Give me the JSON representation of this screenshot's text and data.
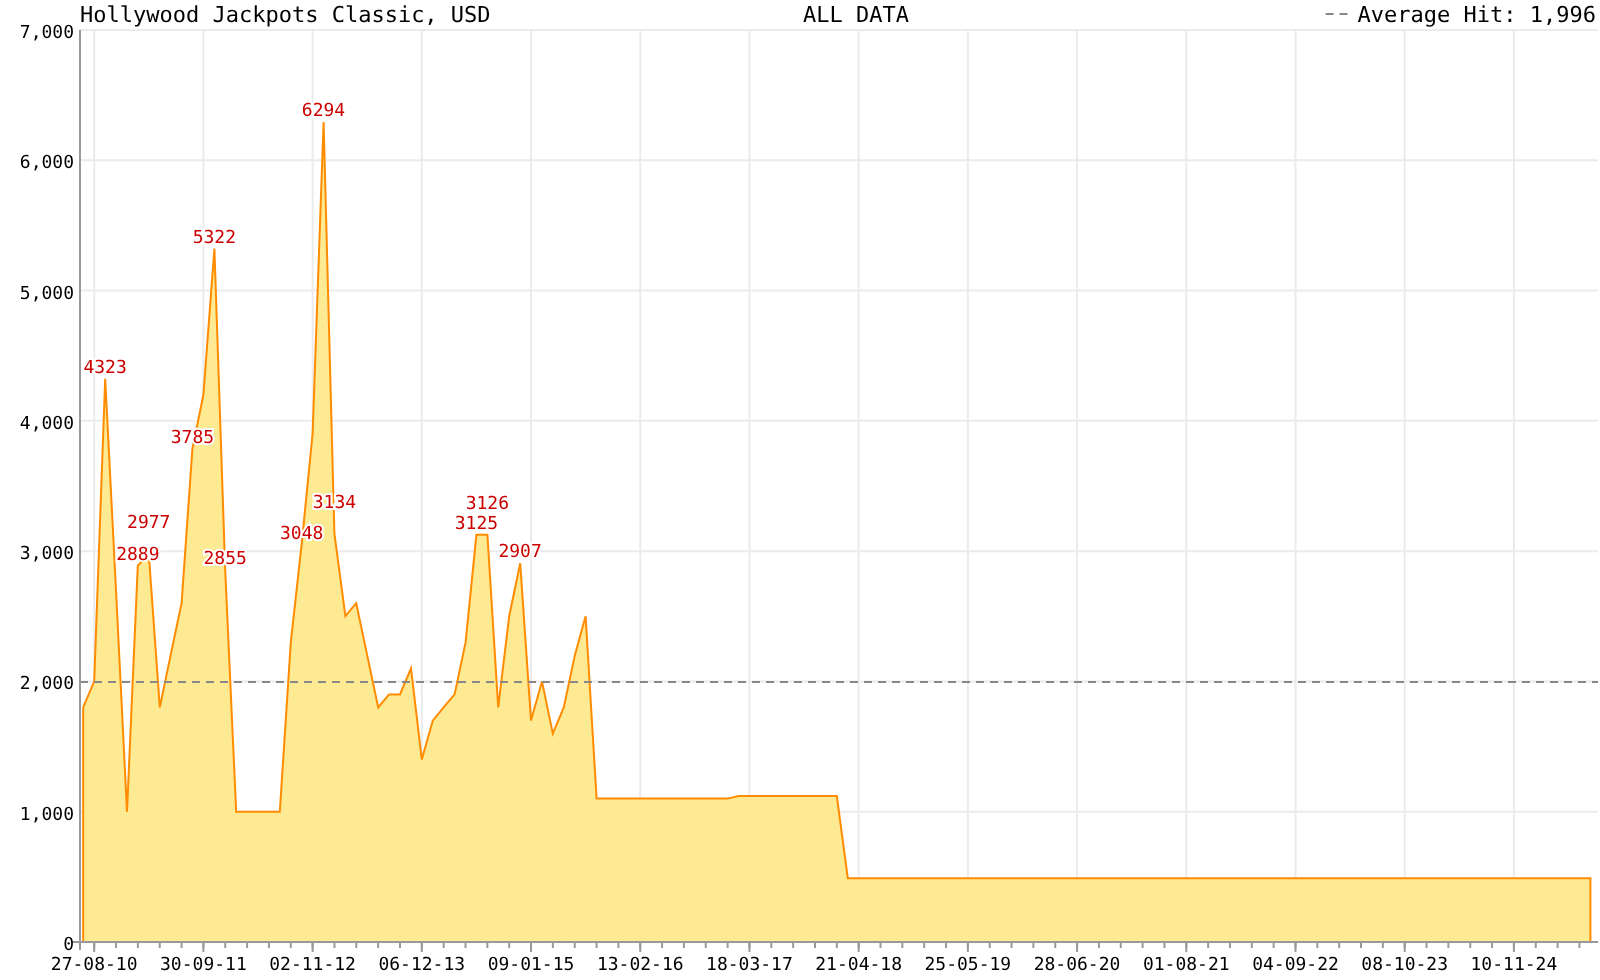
{
  "header": {
    "period": "ALL DATA",
    "legend": "Average Hit: 1,996"
  },
  "chart_data": {
    "type": "area",
    "title": "Hollywood Jackpots Classic, USD",
    "ylim": [
      0,
      7000
    ],
    "yticks": [
      {
        "value": 0,
        "label": "0"
      },
      {
        "value": 1000,
        "label": "1,000"
      },
      {
        "value": 2000,
        "label": "2,000"
      },
      {
        "value": 3000,
        "label": "3,000"
      },
      {
        "value": 4000,
        "label": "4,000"
      },
      {
        "value": 5000,
        "label": "5,000"
      },
      {
        "value": 6000,
        "label": "6,000"
      },
      {
        "value": 7000,
        "label": "7,000"
      }
    ],
    "categories": [
      null,
      "27-08-10",
      null,
      null,
      null,
      null,
      null,
      null,
      null,
      null,
      null,
      "30-09-11",
      null,
      null,
      null,
      null,
      null,
      null,
      null,
      null,
      null,
      "02-11-12",
      null,
      null,
      null,
      null,
      null,
      null,
      null,
      null,
      null,
      "06-12-13",
      null,
      null,
      null,
      null,
      null,
      null,
      null,
      null,
      null,
      "09-01-15",
      null,
      null,
      null,
      null,
      null,
      null,
      null,
      null,
      null,
      "13-02-16",
      null,
      null,
      null,
      null,
      null,
      null,
      null,
      null,
      null,
      "18-03-17",
      null,
      null,
      null,
      null,
      null,
      null,
      null,
      null,
      null,
      "21-04-18",
      null,
      null,
      null,
      null,
      null,
      null,
      null,
      null,
      null,
      "25-05-19",
      null,
      null,
      null,
      null,
      null,
      null,
      null,
      null,
      null,
      "28-06-20",
      null,
      null,
      null,
      null,
      null,
      null,
      null,
      null,
      null,
      "01-08-21",
      null,
      null,
      null,
      null,
      null,
      null,
      null,
      null,
      null,
      "04-09-22",
      null,
      null,
      null,
      null,
      null,
      null,
      null,
      null,
      null,
      "08-10-23",
      null,
      null,
      null,
      null,
      null,
      null,
      null,
      null,
      null,
      "10-11-24",
      null,
      null,
      null,
      null,
      null,
      null,
      null
    ],
    "series": [
      {
        "color": "#ff8c00",
        "values": [
          1800,
          2000,
          4323,
          2700,
          1000,
          2889,
          2977,
          1800,
          2200,
          2600,
          3785,
          4200,
          5322,
          2855,
          1000,
          1000,
          1000,
          1000,
          1000,
          2300,
          3048,
          3900,
          6294,
          3134,
          2500,
          2600,
          2200,
          1800,
          1900,
          1900,
          2100,
          1400,
          1700,
          1800,
          1900,
          2300,
          3125,
          3126,
          1800,
          2500,
          2907,
          1700,
          2000,
          1600,
          1800,
          2200,
          2500,
          1100,
          1100,
          1100,
          1100,
          1100,
          1100,
          1100,
          1100,
          1100,
          1100,
          1100,
          1100,
          1100,
          1120,
          1120,
          1120,
          1120,
          1120,
          1120,
          1120,
          1120,
          1120,
          1120,
          490,
          490,
          490,
          490,
          490,
          490,
          490,
          490,
          490,
          490,
          490,
          490,
          490,
          490,
          490,
          490,
          490,
          490,
          490,
          490,
          490,
          490,
          490,
          490,
          490,
          490,
          490,
          490,
          490,
          490,
          490,
          490,
          490,
          490,
          490,
          490,
          490,
          490,
          490,
          490,
          490,
          490,
          490,
          490,
          490,
          490,
          490,
          490,
          490,
          490,
          490,
          490,
          490,
          490,
          490,
          490,
          490,
          490,
          490,
          490,
          490,
          490,
          490,
          490,
          490,
          490,
          490,
          490,
          490
        ]
      }
    ],
    "ref_lines": [
      {
        "axis": "y",
        "value": 1996
      }
    ],
    "grid": true,
    "annotations": [
      {
        "y": 4323,
        "text": "4323"
      },
      {
        "y": 2889,
        "text": "2889"
      },
      {
        "y": 2977,
        "text": "2977"
      },
      {
        "y": 3785,
        "text": "3785"
      },
      {
        "y": 5322,
        "text": "5322"
      },
      {
        "y": 2855,
        "text": "2855"
      },
      {
        "y": 3048,
        "text": "3048"
      },
      {
        "y": 6294,
        "text": "6294"
      },
      {
        "y": 3134,
        "text": "3134"
      },
      {
        "y": 3125,
        "text": "3125"
      },
      {
        "y": 3126,
        "text": "3126"
      },
      {
        "y": 2907,
        "text": "2907"
      }
    ]
  }
}
